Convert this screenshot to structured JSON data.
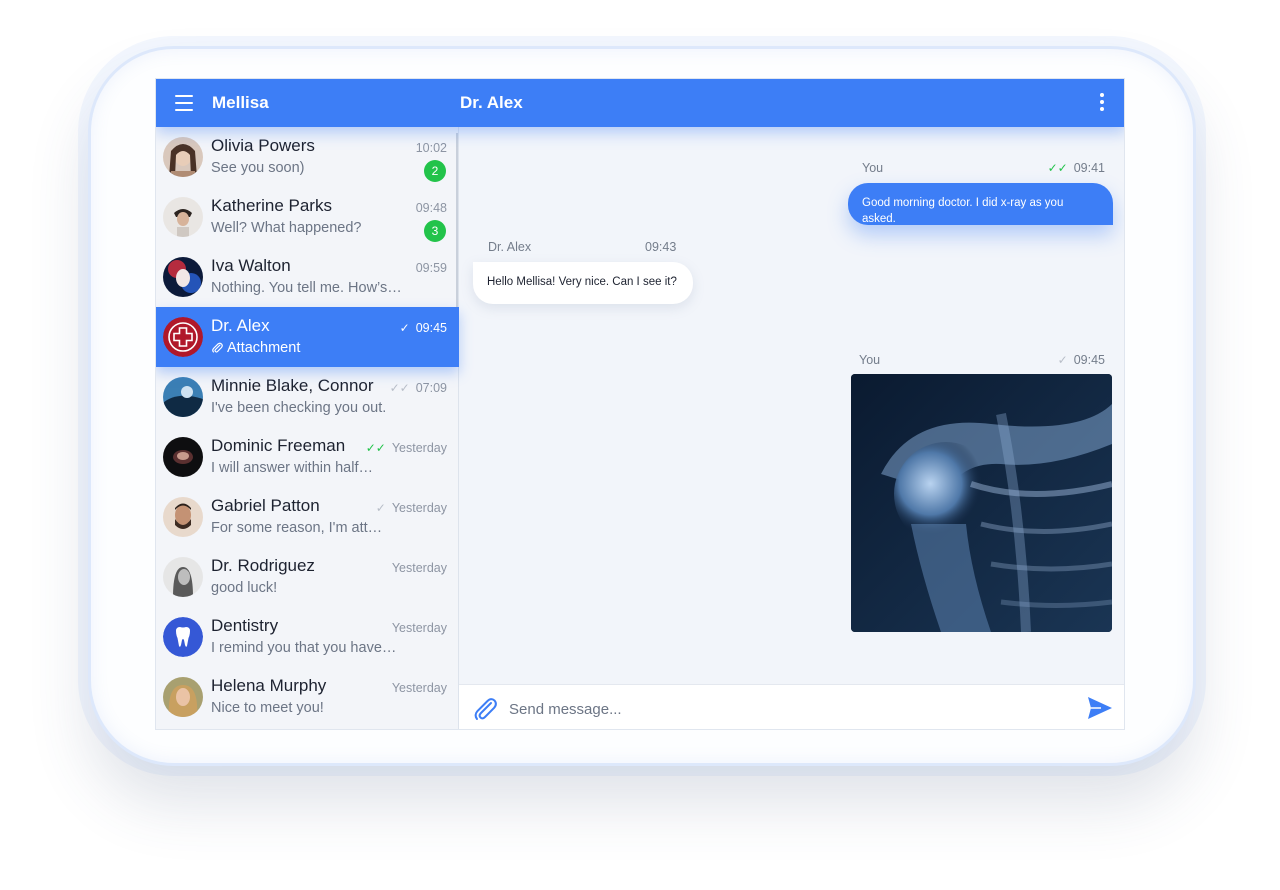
{
  "header": {
    "user_name": "Mellisa",
    "chat_title": "Dr. Alex"
  },
  "sidebar": {
    "chats": [
      {
        "name": "Olivia Powers",
        "preview": "See you soon)",
        "time": "10:02",
        "badge": "2"
      },
      {
        "name": "Katherine Parks",
        "preview": "Well? What happened?",
        "time": "09:48",
        "badge": "3"
      },
      {
        "name": "Iva Walton",
        "preview": "Nothing. You tell me. How’s…",
        "time": "09:59"
      },
      {
        "name": "Dr. Alex",
        "preview": "Attachment",
        "time": "09:45",
        "tick": "✓",
        "active": true
      },
      {
        "name": "Minnie Blake, Connor",
        "preview": "I've been checking you out.",
        "time": "07:09",
        "tick": "✓✓"
      },
      {
        "name": "Dominic Freeman",
        "preview": "I will answer within half…",
        "time": "Yesterday",
        "tick": "✓✓"
      },
      {
        "name": "Gabriel Patton",
        "preview": "For some reason, I'm att…",
        "time": "Yesterday",
        "tick": "✓"
      },
      {
        "name": "Dr. Rodriguez",
        "preview": "good luck!",
        "time": "Yesterday"
      },
      {
        "name": "Dentistry",
        "preview": "I remind you that you have…",
        "time": "Yesterday"
      },
      {
        "name": "Helena Murphy",
        "preview": "Nice to meet you!",
        "time": "Yesterday"
      }
    ]
  },
  "messages": [
    {
      "sender": "You",
      "time": "09:41",
      "tick": "✓✓",
      "text": "Good morning doctor. I did x-ray as you asked."
    },
    {
      "sender": "Dr. Alex",
      "time": "09:43",
      "text": "Hello Mellisa! Very nice. Can I see it?"
    },
    {
      "sender": "You",
      "time": "09:45",
      "tick": "✓",
      "attachment": "shoulder-xray-image"
    }
  ],
  "composer": {
    "placeholder": "Send message..."
  },
  "colors": {
    "accent": "#3d7ef6",
    "badge": "#22c34a",
    "read_tick": "#22c34a"
  }
}
